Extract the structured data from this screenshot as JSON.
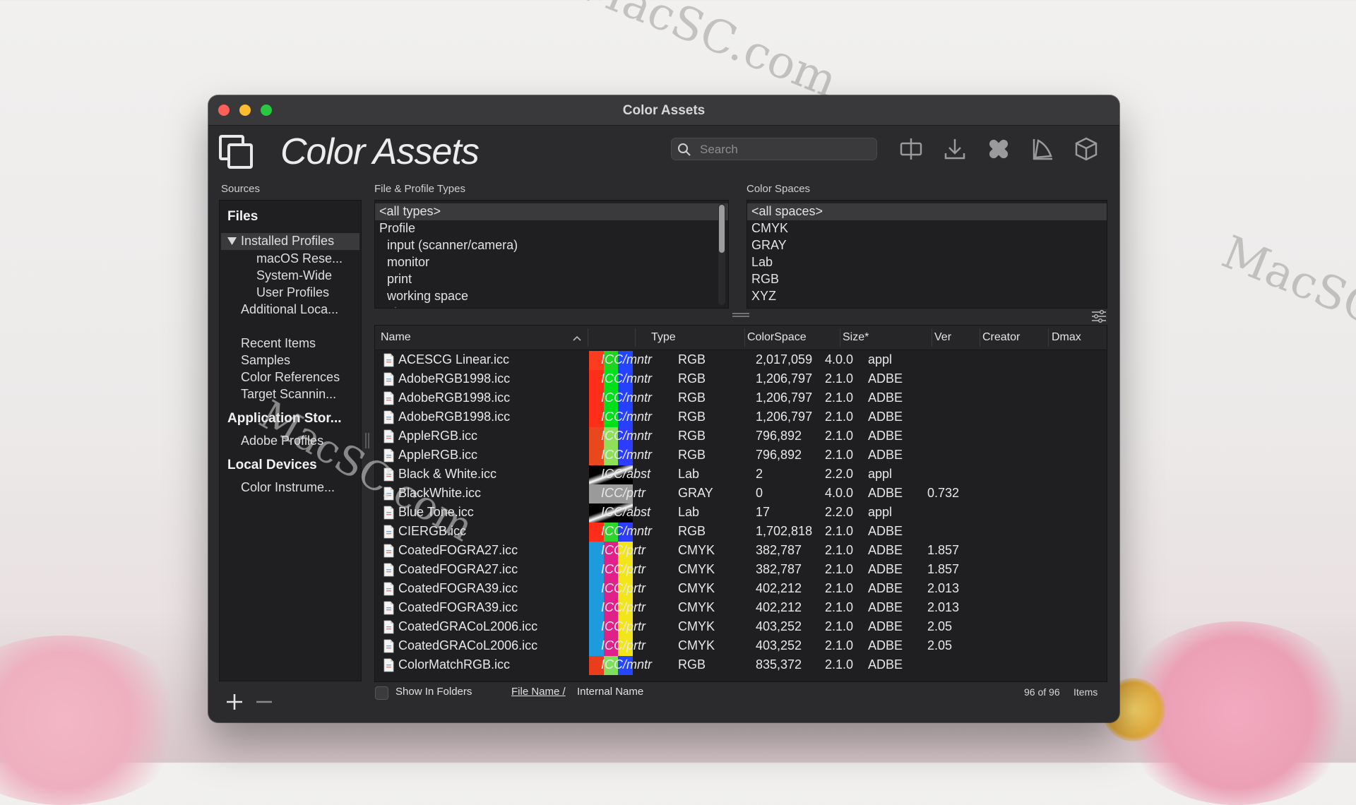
{
  "window": {
    "title": "Color Assets",
    "app_title": "Color Assets"
  },
  "search": {
    "placeholder": "Search"
  },
  "toolbar": {
    "icons": [
      "split-icon",
      "download-icon",
      "bandage-icon",
      "gamut-icon",
      "cube-icon"
    ]
  },
  "labels": {
    "sources": "Sources",
    "types": "File & Profile Types",
    "spaces": "Color Spaces"
  },
  "sidebar": {
    "files_header": "Files",
    "installed_profiles": "Installed Profiles",
    "installed_children": [
      "macOS Rese...",
      "System-Wide",
      "User Profiles"
    ],
    "additional": "Additional Loca...",
    "recent_group": [
      "Recent Items",
      "Samples",
      "Color References",
      "Target Scannin..."
    ],
    "app_store_header": "Application Stor...",
    "app_store_items": [
      "Adobe Profiles"
    ],
    "local_devices_header": "Local Devices",
    "local_devices_items": [
      "Color Instrume..."
    ]
  },
  "types_list": [
    "<all types>",
    "Profile",
    "input (scanner/camera)",
    "monitor",
    "print",
    "working space",
    "abstract"
  ],
  "spaces_list": [
    "<all spaces>",
    "CMYK",
    "GRAY",
    "Lab",
    "RGB",
    "XYZ"
  ],
  "table": {
    "columns": [
      "Name",
      "Type",
      "ColorSpace",
      "Size*",
      "Ver",
      "Creator",
      "Dmax"
    ],
    "rows": [
      {
        "name": "ACESCG Linear.icc",
        "type": "ICC/mntr",
        "space": "RGB",
        "size": "2,017,059",
        "ver": "4.0.0",
        "creator": "appl",
        "dmax": "",
        "swatch": [
          "#ff3b1f",
          "#1fd41f",
          "#2345ff"
        ]
      },
      {
        "name": "AdobeRGB1998.icc",
        "type": "ICC/mntr",
        "space": "RGB",
        "size": "1,206,797",
        "ver": "2.1.0",
        "creator": "ADBE",
        "dmax": "",
        "swatch": [
          "#ff2e1a",
          "#00e01a",
          "#2540ff"
        ]
      },
      {
        "name": "AdobeRGB1998.icc",
        "type": "ICC/mntr",
        "space": "RGB",
        "size": "1,206,797",
        "ver": "2.1.0",
        "creator": "ADBE",
        "dmax": "",
        "swatch": [
          "#ff2e1a",
          "#00e01a",
          "#2540ff"
        ]
      },
      {
        "name": "AdobeRGB1998.icc",
        "type": "ICC/mntr",
        "space": "RGB",
        "size": "1,206,797",
        "ver": "2.1.0",
        "creator": "ADBE",
        "dmax": "",
        "swatch": [
          "#ff2e1a",
          "#00e01a",
          "#2540ff"
        ]
      },
      {
        "name": "AppleRGB.icc",
        "type": "ICC/mntr",
        "space": "RGB",
        "size": "796,892",
        "ver": "2.1.0",
        "creator": "ADBE",
        "dmax": "",
        "swatch": [
          "#e9481e",
          "#8ee05a",
          "#2d3cff"
        ]
      },
      {
        "name": "AppleRGB.icc",
        "type": "ICC/mntr",
        "space": "RGB",
        "size": "796,892",
        "ver": "2.1.0",
        "creator": "ADBE",
        "dmax": "",
        "swatch": [
          "#e9481e",
          "#8ee05a",
          "#2d3cff"
        ]
      },
      {
        "name": "Black & White.icc",
        "type": "ICC/abst",
        "space": "Lab",
        "size": "2",
        "ver": "2.2.0",
        "creator": "appl",
        "dmax": "",
        "swatch": [
          "#000000",
          "#ffffff",
          "#7ad9e8"
        ]
      },
      {
        "name": "BlackWhite.icc",
        "type": "ICC/prtr",
        "space": "GRAY",
        "size": "0",
        "ver": "4.0.0",
        "creator": "ADBE",
        "dmax": "0.732",
        "swatch": [
          "#9a9a9a",
          "#9a9a9a",
          "#9a9a9a"
        ]
      },
      {
        "name": "Blue Tone.icc",
        "type": "ICC/abst",
        "space": "Lab",
        "size": "17",
        "ver": "2.2.0",
        "creator": "appl",
        "dmax": "",
        "swatch": [
          "#000000",
          "#ffffff",
          "#7ad9e8"
        ]
      },
      {
        "name": "CIERGB.icc",
        "type": "ICC/mntr",
        "space": "RGB",
        "size": "1,702,818",
        "ver": "2.1.0",
        "creator": "ADBE",
        "dmax": "",
        "swatch": [
          "#ff2e1a",
          "#2fd42f",
          "#2d3cff"
        ]
      },
      {
        "name": "CoatedFOGRA27.icc",
        "type": "ICC/prtr",
        "space": "CMYK",
        "size": "382,787",
        "ver": "2.1.0",
        "creator": "ADBE",
        "dmax": "1.857",
        "swatch": [
          "#1e9bdc",
          "#e0218a",
          "#f2e51a"
        ]
      },
      {
        "name": "CoatedFOGRA27.icc",
        "type": "ICC/prtr",
        "space": "CMYK",
        "size": "382,787",
        "ver": "2.1.0",
        "creator": "ADBE",
        "dmax": "1.857",
        "swatch": [
          "#1e9bdc",
          "#e0218a",
          "#f2e51a"
        ]
      },
      {
        "name": "CoatedFOGRA39.icc",
        "type": "ICC/prtr",
        "space": "CMYK",
        "size": "402,212",
        "ver": "2.1.0",
        "creator": "ADBE",
        "dmax": "2.013",
        "swatch": [
          "#1e9bdc",
          "#e0218a",
          "#f2e51a"
        ]
      },
      {
        "name": "CoatedFOGRA39.icc",
        "type": "ICC/prtr",
        "space": "CMYK",
        "size": "402,212",
        "ver": "2.1.0",
        "creator": "ADBE",
        "dmax": "2.013",
        "swatch": [
          "#1e9bdc",
          "#e0218a",
          "#f2e51a"
        ]
      },
      {
        "name": "CoatedGRACoL2006.icc",
        "type": "ICC/prtr",
        "space": "CMYK",
        "size": "403,252",
        "ver": "2.1.0",
        "creator": "ADBE",
        "dmax": "2.05",
        "swatch": [
          "#1e9bdc",
          "#e0218a",
          "#f2e51a"
        ]
      },
      {
        "name": "CoatedGRACoL2006.icc",
        "type": "ICC/prtr",
        "space": "CMYK",
        "size": "403,252",
        "ver": "2.1.0",
        "creator": "ADBE",
        "dmax": "2.05",
        "swatch": [
          "#1e9bdc",
          "#e0218a",
          "#f2e51a"
        ]
      },
      {
        "name": "ColorMatchRGB.icc",
        "type": "ICC/mntr",
        "space": "RGB",
        "size": "835,372",
        "ver": "2.1.0",
        "creator": "ADBE",
        "dmax": "",
        "swatch": [
          "#ea3d1c",
          "#7ee05a",
          "#2545ff"
        ]
      }
    ]
  },
  "footer": {
    "show_in_folders": "Show In Folders",
    "file_name": "File Name /",
    "internal_name": "Internal Name",
    "count": "96 of 96",
    "items": "Items"
  },
  "watermark": "MacSC.com",
  "colors": {
    "window_bg": "#2b2b2d",
    "panel_bg": "#1f1f21",
    "selection": "#3a3a3c"
  }
}
